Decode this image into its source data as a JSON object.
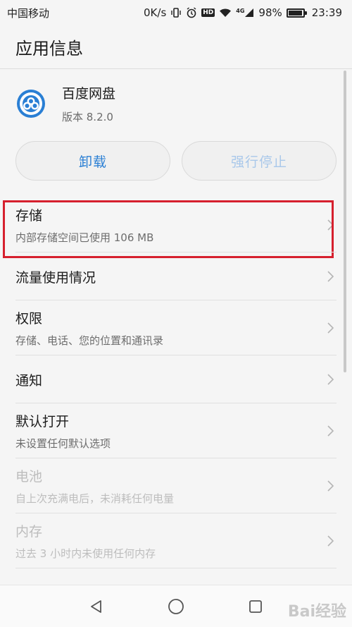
{
  "status_bar": {
    "carrier": "中国移动",
    "speed": "0K/s",
    "hd": "HD",
    "network": "4G",
    "battery": "98%",
    "battery_level": 0.98,
    "time": "23:39"
  },
  "header": {
    "title": "应用信息"
  },
  "app": {
    "name": "百度网盘",
    "version": "版本 8.2.0",
    "icon": "baidu-netdisk-icon",
    "brand_color": "#2a7fd4"
  },
  "buttons": {
    "uninstall": "卸载",
    "force_stop": "强行停止"
  },
  "list": {
    "storage": {
      "title": "存储",
      "subtitle": "内部存储空间已使用 106 MB"
    },
    "data_usage": {
      "title": "流量使用情况"
    },
    "permissions": {
      "title": "权限",
      "subtitle": "存储、电话、您的位置和通讯录"
    },
    "notifications": {
      "title": "通知"
    },
    "open_by_default": {
      "title": "默认打开",
      "subtitle": "未设置任何默认选项"
    },
    "battery": {
      "title": "电池",
      "subtitle": "自上次充满电后，未消耗任何电量"
    },
    "memory": {
      "title": "内存",
      "subtitle": "过去 3 小时内未使用任何内存"
    }
  },
  "highlight_color": "#d6202e",
  "watermark": "Bai经验"
}
